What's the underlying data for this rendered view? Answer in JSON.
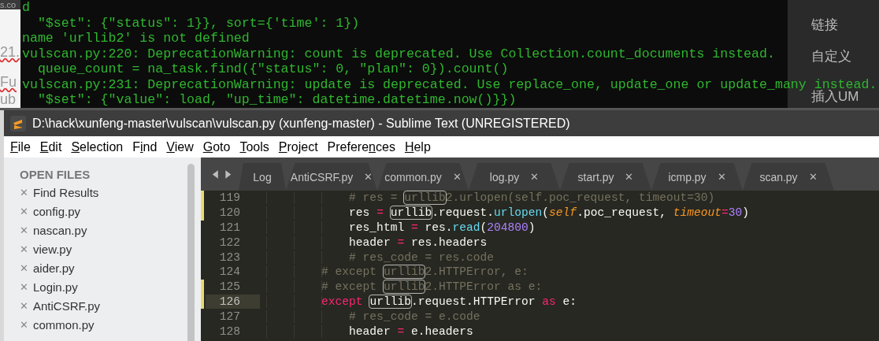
{
  "background_editor": {
    "fragments": [
      "s.co",
      "21.",
      "Fu",
      "ub"
    ]
  },
  "terminal": {
    "lines": [
      "d",
      "  \"$set\": {\"status\": 1}}, sort={'time': 1})",
      "name 'urllib2' is not defined",
      "vulscan.py:220: DeprecationWarning: count is deprecated. Use Collection.count_documents instead.",
      "  queue_count = na_task.find({\"status\": 0, \"plan\": 0}).count()",
      "vulscan.py:231: DeprecationWarning: update is deprecated. Use replace_one, update_one or update_many instead.",
      "  \"$set\": {\"value\": load, \"up_time\": datetime.datetime.now()}})"
    ]
  },
  "side_panel": {
    "items": [
      "链接",
      "自定义",
      "插入UM"
    ]
  },
  "window": {
    "title": "D:\\hack\\xunfeng-master\\vulscan\\vulscan.py (xunfeng-master) - Sublime Text (UNREGISTERED)"
  },
  "menu": [
    {
      "key": "F",
      "after": "ile"
    },
    {
      "key": "E",
      "after": "dit"
    },
    {
      "key": "S",
      "after": "election"
    },
    {
      "before": "F",
      "key": "i",
      "after": "nd"
    },
    {
      "key": "V",
      "after": "iew"
    },
    {
      "key": "G",
      "after": "oto"
    },
    {
      "key": "T",
      "after": "ools"
    },
    {
      "key": "P",
      "after": "roject"
    },
    {
      "before": "Prefere",
      "key": "n",
      "after": "ces"
    },
    {
      "key": "H",
      "after": "elp"
    }
  ],
  "sidebar": {
    "header": "OPEN FILES",
    "close_glyph": "✕",
    "files": [
      "Find Results",
      "config.py",
      "nascan.py",
      "view.py",
      "aider.py",
      "Login.py",
      "AntiCSRF.py",
      "common.py"
    ]
  },
  "tabs": [
    {
      "label": "Log"
    },
    {
      "label": "AntiCSRF.py",
      "close": "✕"
    },
    {
      "label": "common.py",
      "close": "✕"
    },
    {
      "label": "log.py",
      "close": "✕"
    },
    {
      "label": "start.py",
      "close": "✕"
    },
    {
      "label": "icmp.py",
      "close": "✕"
    },
    {
      "label": "scan.py",
      "close": "✕"
    }
  ],
  "code": [
    {
      "number": "119",
      "modified": true,
      "current": false,
      "tokens": [
        {
          "kind": "comment",
          "text": "            # res = "
        },
        {
          "kind": "match-comment",
          "text": "urllib"
        },
        {
          "kind": "comment",
          "text": "2.urlopen(self.poc_request, timeout=30)"
        }
      ]
    },
    {
      "number": "120",
      "modified": true,
      "current": false,
      "tokens": [
        {
          "kind": "plain",
          "text": "            res "
        },
        {
          "kind": "operator",
          "text": "= "
        },
        {
          "kind": "match",
          "text": "urllib"
        },
        {
          "kind": "plain",
          "text": ".request."
        },
        {
          "kind": "function",
          "text": "urlopen"
        },
        {
          "kind": "plain",
          "text": "("
        },
        {
          "kind": "self",
          "text": "self"
        },
        {
          "kind": "plain",
          "text": ".poc_request, "
        },
        {
          "kind": "param",
          "text": "timeout"
        },
        {
          "kind": "operator",
          "text": "="
        },
        {
          "kind": "number",
          "text": "30"
        },
        {
          "kind": "plain",
          "text": ")"
        }
      ]
    },
    {
      "number": "121",
      "modified": false,
      "current": false,
      "tokens": [
        {
          "kind": "plain",
          "text": "            res_html "
        },
        {
          "kind": "operator",
          "text": "="
        },
        {
          "kind": "plain",
          "text": " res."
        },
        {
          "kind": "function",
          "text": "read"
        },
        {
          "kind": "plain",
          "text": "("
        },
        {
          "kind": "number",
          "text": "204800"
        },
        {
          "kind": "plain",
          "text": ")"
        }
      ]
    },
    {
      "number": "122",
      "modified": false,
      "current": false,
      "tokens": [
        {
          "kind": "plain",
          "text": "            header "
        },
        {
          "kind": "operator",
          "text": "="
        },
        {
          "kind": "plain",
          "text": " res.headers"
        }
      ]
    },
    {
      "number": "123",
      "modified": false,
      "current": false,
      "tokens": [
        {
          "kind": "comment",
          "text": "            # res_code = res.code"
        }
      ]
    },
    {
      "number": "124",
      "modified": false,
      "current": false,
      "tokens": [
        {
          "kind": "comment",
          "text": "        # except "
        },
        {
          "kind": "match-comment",
          "text": "urllib"
        },
        {
          "kind": "comment",
          "text": "2.HTTPError, e:"
        }
      ]
    },
    {
      "number": "125",
      "modified": true,
      "current": false,
      "tokens": [
        {
          "kind": "comment",
          "text": "        # except "
        },
        {
          "kind": "match-comment",
          "text": "urllib"
        },
        {
          "kind": "comment",
          "text": "2.HTTPError as e:"
        }
      ]
    },
    {
      "number": "126",
      "modified": true,
      "current": true,
      "tokens": [
        {
          "kind": "keyword",
          "text": "        except "
        },
        {
          "kind": "match",
          "text": "urllib"
        },
        {
          "kind": "plain",
          "text": ".request.HTTPError "
        },
        {
          "kind": "keyword",
          "text": "as"
        },
        {
          "kind": "plain",
          "text": " e:"
        }
      ]
    },
    {
      "number": "127",
      "modified": false,
      "current": false,
      "tokens": [
        {
          "kind": "comment",
          "text": "            # res_code = e.code"
        }
      ]
    },
    {
      "number": "128",
      "modified": false,
      "current": false,
      "tokens": [
        {
          "kind": "plain",
          "text": "            header "
        },
        {
          "kind": "operator",
          "text": "="
        },
        {
          "kind": "plain",
          "text": " e.headers"
        }
      ]
    }
  ]
}
